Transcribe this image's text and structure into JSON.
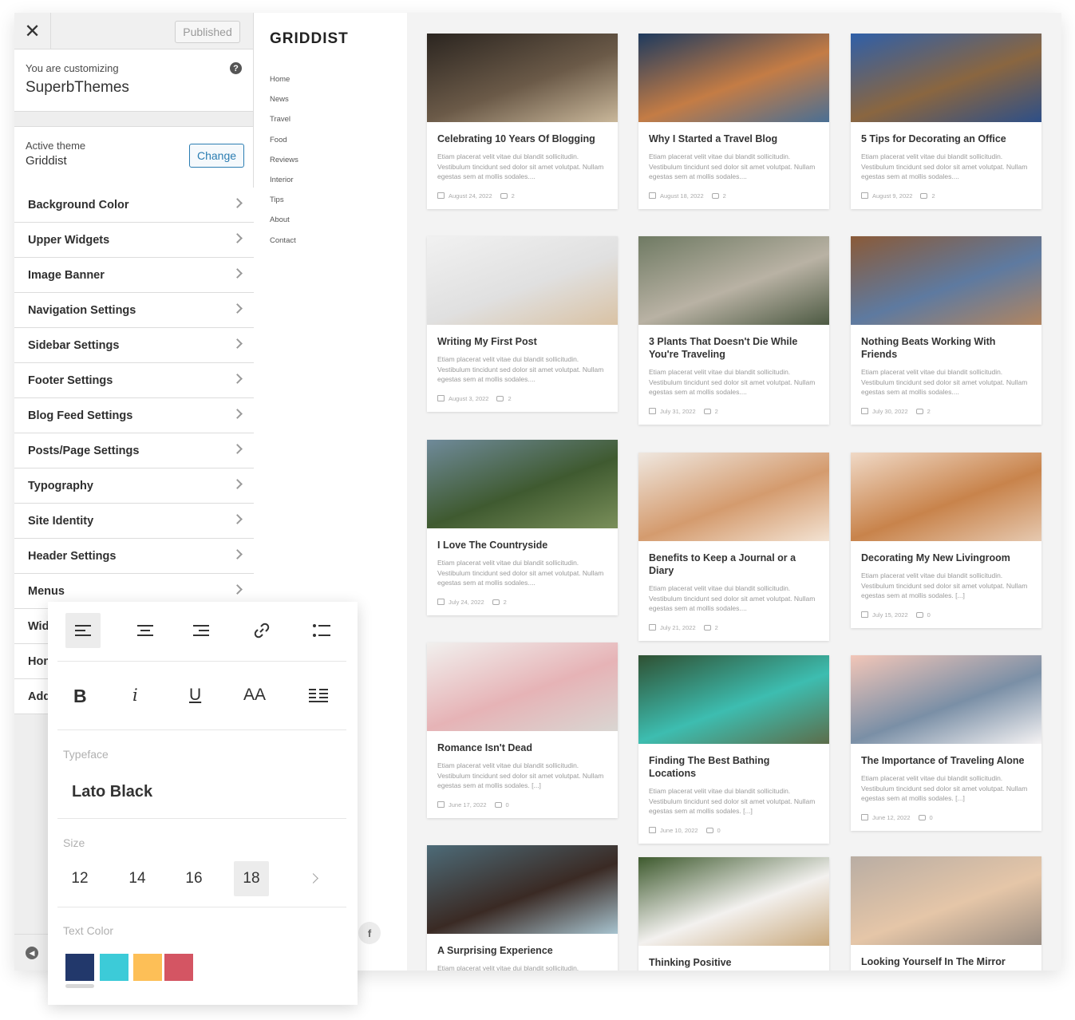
{
  "customizer": {
    "published_label": "Published",
    "customizing_label": "You are customizing",
    "site_name": "SuperbThemes",
    "active_theme_label": "Active theme",
    "active_theme_name": "Griddist",
    "change_label": "Change",
    "menu": [
      {
        "label": "Background Color"
      },
      {
        "label": "Upper Widgets"
      },
      {
        "label": "Image Banner"
      },
      {
        "label": "Navigation Settings"
      },
      {
        "label": "Sidebar Settings"
      },
      {
        "label": "Footer Settings"
      },
      {
        "label": "Blog Feed Settings"
      },
      {
        "label": "Posts/Page Settings"
      },
      {
        "label": "Typography"
      },
      {
        "label": "Site Identity"
      },
      {
        "label": "Header Settings"
      },
      {
        "label": "Menus"
      },
      {
        "label": "Wid"
      },
      {
        "label": "Hon"
      },
      {
        "label": "Add"
      }
    ]
  },
  "site": {
    "logo": "GRIDDIST",
    "nav": [
      "Home",
      "News",
      "Travel",
      "Food",
      "Reviews",
      "Interior",
      "Tips",
      "About",
      "Contact"
    ]
  },
  "excerpt": {
    "short": "Etiam placerat velit vitae dui blandit sollicitudin. Vestibulum tincidunt sed dolor sit amet volutpat. Nullam egestas sem at mollis sodales....",
    "bracket": "Etiam placerat velit vitae dui blandit sollicitudin. Vestibulum tincidunt sed dolor sit amet volutpat. Nullam egestas sem at mollis sodales. [...]",
    "single": "Etiam placerat velit vitae dui blandit sollicitudin."
  },
  "posts": [
    {
      "title": "Celebrating 10 Years Of Blogging",
      "date": "August 24, 2022",
      "comments": "2"
    },
    {
      "title": "Why I Started a Travel Blog",
      "date": "August 18, 2022",
      "comments": "2"
    },
    {
      "title": "5 Tips for Decorating an Office",
      "date": "August 9, 2022",
      "comments": "2"
    },
    {
      "title": "Writing My First Post",
      "date": "August 3, 2022",
      "comments": "2"
    },
    {
      "title": "3 Plants That Doesn't Die While You're Traveling",
      "date": "July 31, 2022",
      "comments": "2"
    },
    {
      "title": "Nothing Beats Working With Friends",
      "date": "July 30, 2022",
      "comments": "2"
    },
    {
      "title": "I Love The Countryside",
      "date": "July 24, 2022",
      "comments": "2"
    },
    {
      "title": "Benefits to Keep a Journal or a Diary",
      "date": "July 21, 2022",
      "comments": "2"
    },
    {
      "title": "Decorating My New Livingroom",
      "date": "July 15, 2022",
      "comments": "0"
    },
    {
      "title": "Romance Isn't Dead",
      "date": "June 17, 2022",
      "comments": "0"
    },
    {
      "title": "Finding The Best Bathing Locations",
      "date": "June 10, 2022",
      "comments": "0"
    },
    {
      "title": "The Importance of Traveling Alone",
      "date": "June 12, 2022",
      "comments": "0"
    },
    {
      "title": "A Surprising Experience"
    },
    {
      "title": "Thinking Positive"
    },
    {
      "title": "Looking Yourself In The Mirror"
    }
  ],
  "toolbar": {
    "format_labels": [
      "B",
      "i",
      "U",
      "AA"
    ],
    "typeface_label": "Typeface",
    "typeface_value": "Lato Black",
    "size_label": "Size",
    "sizes": [
      "12",
      "14",
      "16",
      "18"
    ],
    "selected_size": "18",
    "text_color_label": "Text Color",
    "colors": [
      "#22386b",
      "#3ccbd8",
      "#fdbf57",
      "#d45563"
    ]
  },
  "icons": {
    "close": "close-icon",
    "help": "help-icon",
    "facebook": "facebook-icon",
    "collapse": "collapse-icon"
  }
}
